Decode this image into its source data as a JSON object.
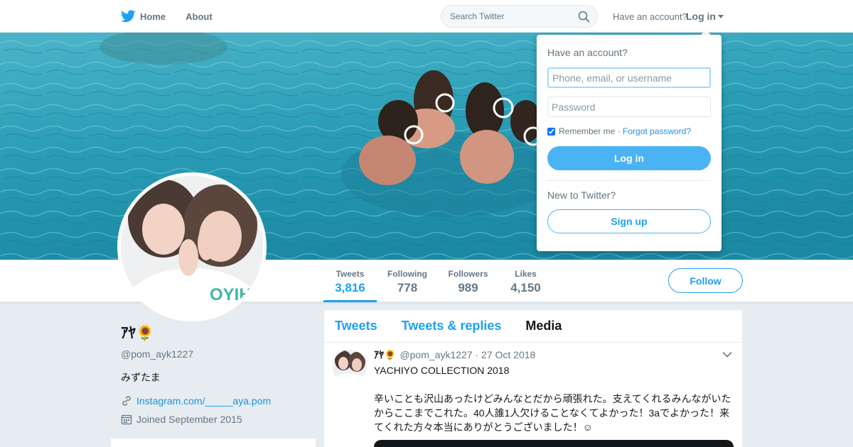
{
  "nav": {
    "home_label": "Home",
    "about_label": "About",
    "search_placeholder": "Search Twitter",
    "have_account": "Have an account?",
    "login_label": "Log in"
  },
  "profile": {
    "name": "ｱﾔ🌻",
    "handle": "@pom_ayk1227",
    "bio": "みずたま",
    "link_text": "Instagram.com/_____aya.pom",
    "joined": "Joined September 2015"
  },
  "stats": [
    {
      "label": "Tweets",
      "value": "3,816",
      "active": true
    },
    {
      "label": "Following",
      "value": "778",
      "active": false
    },
    {
      "label": "Followers",
      "value": "989",
      "active": false
    },
    {
      "label": "Likes",
      "value": "4,150",
      "active": false
    }
  ],
  "follow_label": "Follow",
  "timeline": {
    "tabs": [
      {
        "label": "Tweets"
      },
      {
        "label": "Tweets & replies"
      },
      {
        "label": "Media",
        "selected": true
      }
    ],
    "tweet": {
      "name": "ｱﾔ🌻",
      "meta": "@pom_ayk1227 · 27 Oct 2018",
      "text": "YACHIYO COLLECTION 2018\n\n辛いことも沢山あったけどみんなとだから頑張れた。支えてくれるみんながいたからここまでこれた。40人誰1人欠けることなくてよかった！3aでよかった！来てくれた方々本当にありがとうございました！☺"
    }
  },
  "login_dropdown": {
    "title": "Have an account?",
    "username_placeholder": "Phone, email, or username",
    "password_placeholder": "Password",
    "remember_me": "Remember me",
    "separator": " · ",
    "forgot_password": "Forgot password?",
    "login_button": "Log in",
    "new_to_twitter": "New to Twitter?",
    "signup_button": "Sign up"
  },
  "colors": {
    "accent": "#1da1f2",
    "link": "#1b95e0",
    "login_button_bg": "#4ab3f4",
    "page_bg": "#e6ecf0"
  }
}
